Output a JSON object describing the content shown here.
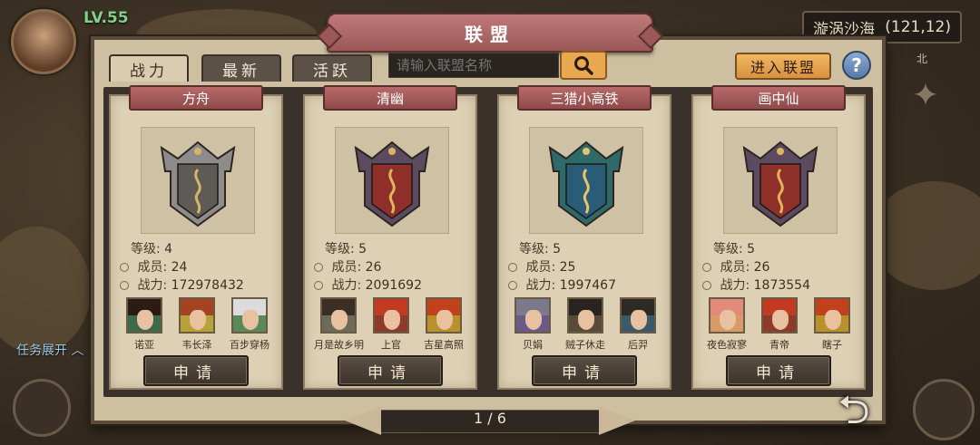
{
  "hud": {
    "level": "LV.55",
    "location_name": "漩涡沙海",
    "coords": "(121,12)",
    "task_toggle": "任务展开",
    "compass_north": "北"
  },
  "panel": {
    "title": "联盟",
    "tabs": [
      {
        "label": "战力",
        "active": true
      },
      {
        "label": "最新",
        "active": false
      },
      {
        "label": "活跃",
        "active": false
      }
    ],
    "search": {
      "placeholder": "请输入联盟名称",
      "icon": "search-icon"
    },
    "join_label": "进入联盟",
    "help_label": "?",
    "apply_label": "申请",
    "stat_labels": {
      "level": "等级:",
      "members": "成员:",
      "power": "战力:"
    }
  },
  "alliances": [
    {
      "name": "方舟",
      "level": "4",
      "members": "24",
      "power": "172978432",
      "emblem": {
        "shield": "#8e8c8a",
        "inner": "#5e5a56",
        "symbol": "#d7b46a"
      },
      "leaders": [
        {
          "name": "诺亚",
          "hair": "#2a1c14",
          "bg": "#3b6b4a"
        },
        {
          "name": "韦长泽",
          "hair": "#a3431f",
          "bg": "#b7a23a"
        },
        {
          "name": "百步穿杨",
          "hair": "#dcdcdc",
          "bg": "#5a8a5a"
        }
      ]
    },
    {
      "name": "清幽",
      "level": "5",
      "members": "26",
      "power": "2091692",
      "emblem": {
        "shield": "#5c4b60",
        "inner": "#8e2f2a",
        "symbol": "#e0b45a"
      },
      "leaders": [
        {
          "name": "月是故乡明",
          "hair": "#3b2e24",
          "bg": "#6e6a5a"
        },
        {
          "name": "上官",
          "hair": "#c23a22",
          "bg": "#8e3a2a"
        },
        {
          "name": "吉星高照",
          "hair": "#c2401c",
          "bg": "#b9902a"
        }
      ]
    },
    {
      "name": "三猎小高铁",
      "level": "5",
      "members": "25",
      "power": "1997467",
      "emblem": {
        "shield": "#2f6a6a",
        "inner": "#2a5c78",
        "symbol": "#e8c468"
      },
      "leaders": [
        {
          "name": "贝娟",
          "hair": "#7a7a8a",
          "bg": "#6a5a8a"
        },
        {
          "name": "贼子休走",
          "hair": "#2a2420",
          "bg": "#5a4a3a"
        },
        {
          "name": "后羿",
          "hair": "#2e2a24",
          "bg": "#3a5a6a"
        }
      ]
    },
    {
      "name": "画中仙",
      "level": "5",
      "members": "26",
      "power": "1873554",
      "emblem": {
        "shield": "#5c4b60",
        "inner": "#8e2f2a",
        "symbol": "#e0b45a"
      },
      "leaders": [
        {
          "name": "夜色寂寥",
          "hair": "#e38a7a",
          "bg": "#d99a6a"
        },
        {
          "name": "青帝",
          "hair": "#c23a22",
          "bg": "#8e3a2a"
        },
        {
          "name": "瞎子",
          "hair": "#c2401c",
          "bg": "#b9902a"
        }
      ]
    }
  ],
  "pager": {
    "text": "1 / 6"
  },
  "back_icon": "back-arrow-icon"
}
